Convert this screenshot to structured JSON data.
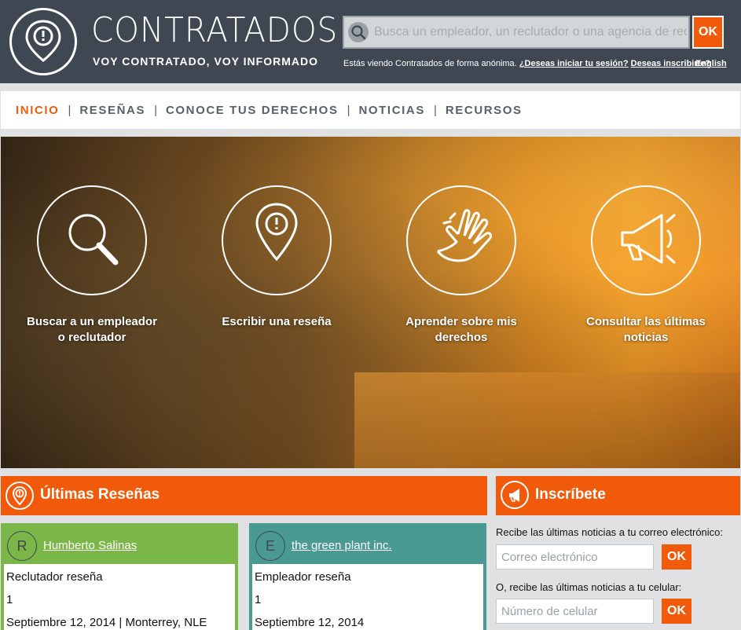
{
  "header": {
    "brand": "CONTRATADOS",
    "tagline": "VOY CONTRATADO, VOY INFORMADO",
    "search_placeholder": "Busca un empleador, un reclutador o una agencia de reclu",
    "search_ok": "OK",
    "anon_text": "Estás viendo Contratados de forma anónima.",
    "login_link": "¿Deseas iniciar tu sesión?",
    "signup_link": "Deseas inscribirte?",
    "language_link": "English"
  },
  "nav": {
    "items": [
      "INICIO",
      "RESEÑAS",
      "CONOCE TUS DERECHOS",
      "NOTICIAS",
      "RECURSOS"
    ],
    "separator": "|"
  },
  "hero": {
    "items": [
      {
        "label": "Buscar a un empleador o reclutador",
        "icon": "search-icon"
      },
      {
        "label": "Escribir una reseña",
        "icon": "map-pin-alert-icon"
      },
      {
        "label": "Aprender sobre mis derechos",
        "icon": "hand-icon"
      },
      {
        "label": "Consultar las últimas noticias",
        "icon": "megaphone-icon"
      }
    ]
  },
  "reviews": {
    "title": "Últimas Reseñas",
    "cards": [
      {
        "initial": "R",
        "name": "Humberto Salinas",
        "type": "Reclutador reseña",
        "rating": "1",
        "meta": "Septiembre 12, 2014 | Monterrey, NLE",
        "color": "#7ab648"
      },
      {
        "initial": "E",
        "name": "the green plant inc.",
        "type": "Empleador reseña",
        "rating": "1",
        "meta": "Septiembre 12, 2014",
        "color": "#4a9a93"
      }
    ]
  },
  "subscribe": {
    "title": "Inscríbete",
    "email_prompt": "Recibe las últimas noticias a tu correo electrónico:",
    "email_placeholder": "Correo electrónico",
    "email_ok": "OK",
    "phone_prompt": "O, recibe las últimas noticias a tu celular:",
    "phone_placeholder": "Número de celular",
    "phone_ok": "OK"
  },
  "colors": {
    "accent": "#f15a0a",
    "header_bg": "#3f4752",
    "green": "#7ab648",
    "teal": "#4a9a93"
  }
}
